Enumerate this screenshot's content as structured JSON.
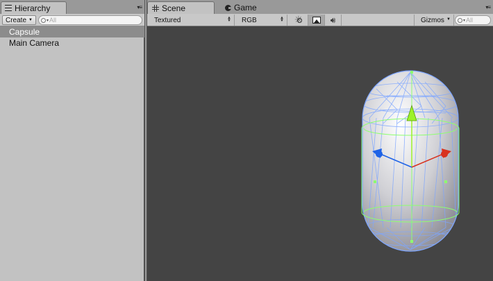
{
  "hierarchy": {
    "tab_label": "Hierarchy",
    "create_label": "Create",
    "search_placeholder": "All",
    "items": [
      {
        "label": "Capsule",
        "selected": true
      },
      {
        "label": "Main Camera",
        "selected": false
      }
    ]
  },
  "scene": {
    "tabs": [
      {
        "label": "Scene",
        "icon": "grid-icon",
        "active": true
      },
      {
        "label": "Game",
        "icon": "pacman-icon",
        "active": false
      }
    ],
    "render_mode": "Textured",
    "color_mode": "RGB",
    "gizmos_label": "Gizmos",
    "search_placeholder": "All",
    "lighting_toggle": false,
    "image_effects_toggle": true,
    "audio_toggle": false
  },
  "colors": {
    "viewport_bg": "#444444",
    "wireframe": "#7ea6ff",
    "collider": "#8dff70",
    "axis_x": "#d8331f",
    "axis_y": "#9cf22a",
    "axis_z": "#1f63e6",
    "selected_row": "#8c8c8c"
  },
  "viewport_object": "capsule"
}
